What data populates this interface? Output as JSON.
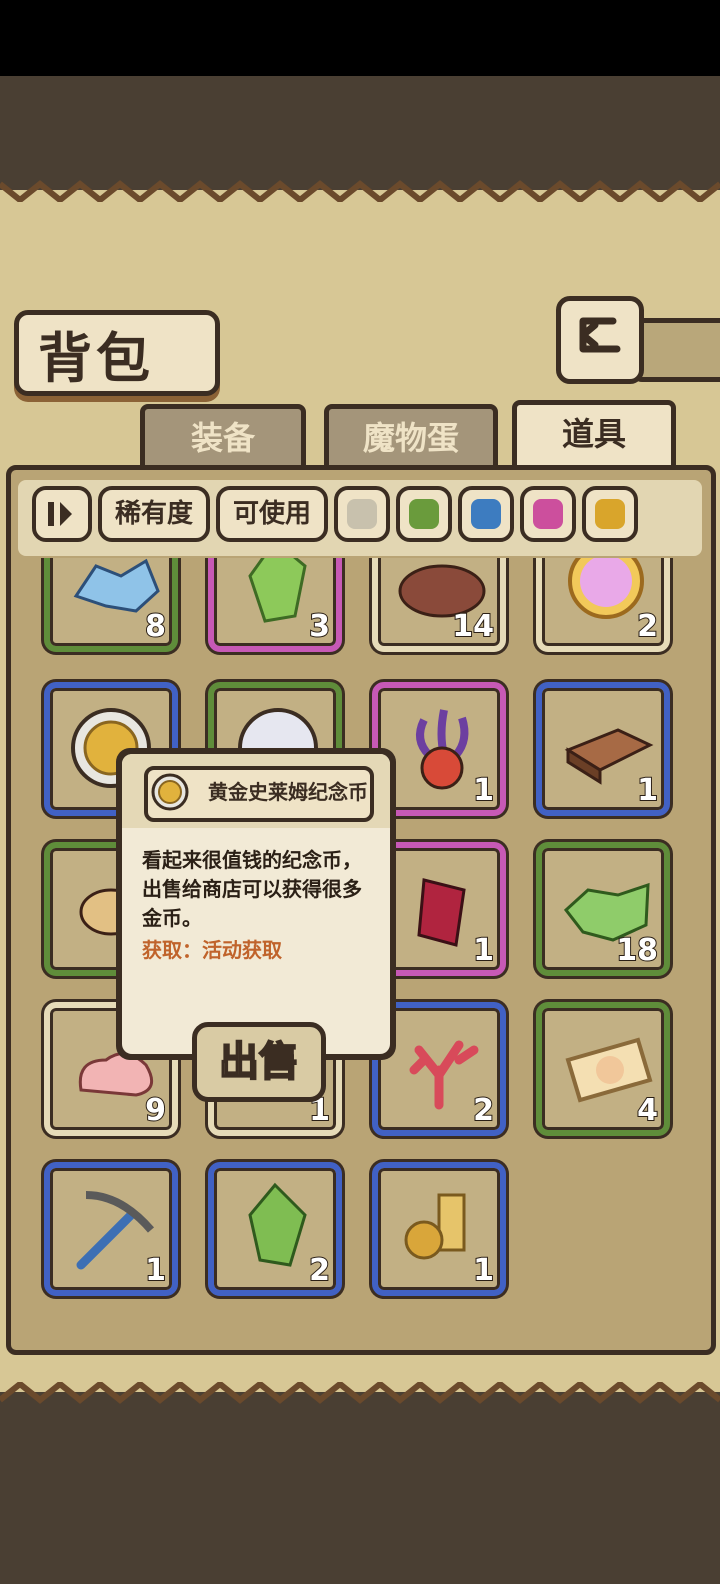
{
  "title": "背包",
  "tabs": [
    {
      "label": "装备",
      "active": false
    },
    {
      "label": "魔物蛋",
      "active": false
    },
    {
      "label": "道具",
      "active": true
    }
  ],
  "filters": {
    "sort_icon": "sort-toggle-icon",
    "rarity_label": "稀有度",
    "usable_label": "可使用",
    "rarity_colors": [
      {
        "name": "white",
        "color": "#c8c1ad"
      },
      {
        "name": "green",
        "color": "#6a9b3c"
      },
      {
        "name": "blue",
        "color": "#3d7cc0"
      },
      {
        "name": "pink",
        "color": "#cc4f9d"
      },
      {
        "name": "gold",
        "color": "#d9a52b"
      }
    ]
  },
  "items": [
    {
      "name": "blue-crystal-cluster",
      "rarity": "green",
      "count": "8"
    },
    {
      "name": "green-gem",
      "rarity": "pink",
      "count": "3"
    },
    {
      "name": "dirt-mound",
      "rarity": "white",
      "count": "14"
    },
    {
      "name": "rainbow-orb",
      "rarity": "white",
      "count": "2"
    },
    {
      "name": "golden-slime-coin",
      "rarity": "blue",
      "count": ""
    },
    {
      "name": "pearl",
      "rarity": "green",
      "count": ""
    },
    {
      "name": "tentacle-eye",
      "rarity": "pink",
      "count": "1"
    },
    {
      "name": "wood-brick",
      "rarity": "blue",
      "count": "1"
    },
    {
      "name": "bread-lump",
      "rarity": "green",
      "count": ""
    },
    {
      "name": "item-hidden",
      "rarity": "green",
      "count": ""
    },
    {
      "name": "red-crystal",
      "rarity": "pink",
      "count": "1"
    },
    {
      "name": "green-ore",
      "rarity": "green",
      "count": "18"
    },
    {
      "name": "pink-goo",
      "rarity": "white",
      "count": "9"
    },
    {
      "name": "item-hidden-2",
      "rarity": "white",
      "count": "1"
    },
    {
      "name": "red-coral",
      "rarity": "blue",
      "count": "2"
    },
    {
      "name": "creature-ticket",
      "rarity": "green",
      "count": "4"
    },
    {
      "name": "pickaxe",
      "rarity": "blue",
      "count": "1"
    },
    {
      "name": "green-shard",
      "rarity": "blue",
      "count": "2"
    },
    {
      "name": "golden-treasure",
      "rarity": "blue",
      "count": "1"
    }
  ],
  "tooltip": {
    "item_name": "黄金史莱姆纪念币",
    "description": "看起来很值钱的纪念币，出售给商店可以获得很多金币。",
    "source": "获取：活动获取",
    "sell_label": "出售"
  }
}
